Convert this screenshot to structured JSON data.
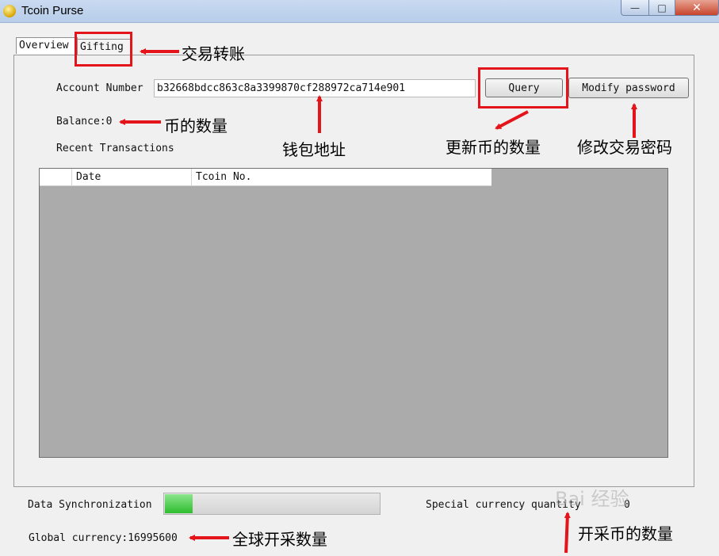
{
  "window": {
    "title": "Tcoin Purse",
    "minimize_glyph": "—",
    "maximize_glyph": "□",
    "close_glyph": "✕"
  },
  "tabs": [
    {
      "label": "Overview",
      "selected": true
    },
    {
      "label": "Gifting",
      "selected": false
    }
  ],
  "overview": {
    "account_label": "Account Number",
    "account_value": "b32668bdcc863c8a3399870cf288972ca714e901",
    "query_button": "Query",
    "modify_password_button": "Modify password",
    "balance": "Balance:0",
    "recent_transactions_label": "Recent Transactions",
    "table_columns": [
      "",
      "Date",
      "Tcoin No."
    ]
  },
  "status": {
    "sync_label": "Data Synchronization",
    "sync_progress_fraction": 0.13,
    "special_currency_label": "Special currency quantity",
    "special_currency_value": "0",
    "global_currency": "Global currency:16995600"
  },
  "annotations": {
    "gifting_note": "交易转账",
    "balance_note": "币的数量",
    "address_note": "钱包地址",
    "query_note": "更新币的数量",
    "modify_note": "修改交易密码",
    "global_note": "全球开采数量",
    "special_note": "开采币的数量"
  },
  "watermark": "Bai 经验",
  "colors": {
    "annotation_red": "#e3141a",
    "table_background": "#ababab",
    "progress_green": "#2fbd2f"
  }
}
